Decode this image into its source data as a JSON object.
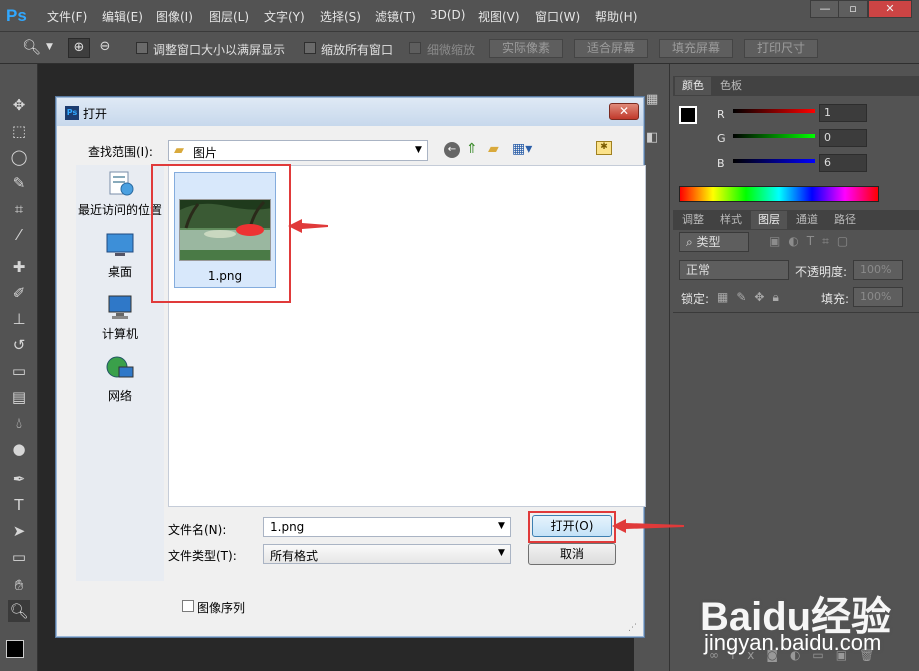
{
  "app": {
    "logo": "Ps"
  },
  "menu": [
    "文件(F)",
    "编辑(E)",
    "图像(I)",
    "图层(L)",
    "文字(Y)",
    "选择(S)",
    "滤镜(T)",
    "3D(D)",
    "视图(V)",
    "窗口(W)",
    "帮助(H)"
  ],
  "options": {
    "chk1_label": "调整窗口大小以满屏显示",
    "chk2_label": "缩放所有窗口",
    "chk3_label": "细微缩放",
    "btn_actual": "实际像素",
    "btn_fit": "适合屏幕",
    "btn_fill": "填充屏幕",
    "btn_print": "打印尺寸"
  },
  "color_panel": {
    "tabs": [
      "颜色",
      "色板"
    ],
    "r_label": "R",
    "g_label": "G",
    "b_label": "B",
    "r_value": "1",
    "g_value": "0",
    "b_value": "6"
  },
  "layers_panel": {
    "tabs": [
      "调整",
      "样式",
      "图层",
      "通道",
      "路径"
    ],
    "filter_label": "类型",
    "blend_mode": "正常",
    "opacity_label": "不透明度:",
    "opacity_value": "100%",
    "lock_label": "锁定:",
    "fill_label": "填充:",
    "fill_value": "100%"
  },
  "dialog": {
    "title": "打开",
    "lookin_label": "查找范围(I):",
    "lookin_value": "图片",
    "places": [
      "最近访问的位置",
      "桌面",
      "计算机",
      "网络"
    ],
    "file_item": "1.png",
    "filename_label": "文件名(N):",
    "filename_value": "1.png",
    "filetype_label": "文件类型(T):",
    "filetype_value": "所有格式",
    "open_button": "打开(O)",
    "cancel_button": "取消",
    "sequence_label": "图像序列"
  },
  "watermark": {
    "logo": "Baidu经验",
    "url": "jingyan.baidu.com"
  }
}
